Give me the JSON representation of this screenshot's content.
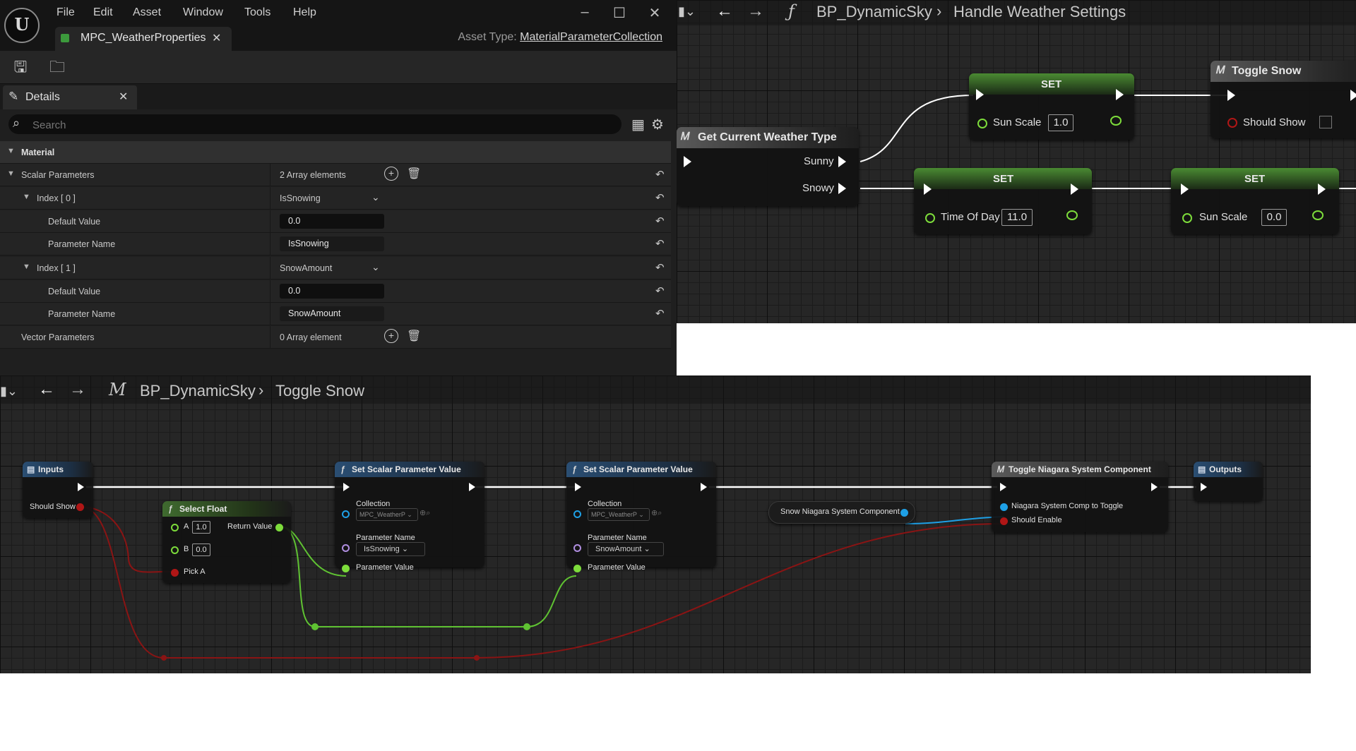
{
  "mpc_window": {
    "menu": [
      "File",
      "Edit",
      "Asset",
      "Window",
      "Tools",
      "Help"
    ],
    "asset_tab": "MPC_WeatherProperties",
    "asset_type_label": "Asset Type:",
    "asset_type_value": "MaterialParameterCollection",
    "details_tab": "Details",
    "search_placeholder": "Search",
    "section": "Material",
    "scalar_params_label": "Scalar Parameters",
    "scalar_params_count": "2 Array elements",
    "index0": {
      "label": "Index [ 0 ]",
      "value": "IsSnowing",
      "default_label": "Default Value",
      "default_value": "0.0",
      "param_label": "Parameter Name",
      "param_value": "IsSnowing"
    },
    "index1": {
      "label": "Index [ 1 ]",
      "value": "SnowAmount",
      "default_label": "Default Value",
      "default_value": "0.0",
      "param_label": "Parameter Name",
      "param_value": "SnowAmount"
    },
    "vector_params_label": "Vector Parameters",
    "vector_params_count": "0 Array element"
  },
  "graph_top": {
    "breadcrumb_root": "BP_DynamicSky",
    "breadcrumb_leaf": "Handle Weather Settings",
    "get_weather": {
      "title": "Get Current Weather Type",
      "out1": "Sunny",
      "out2": "Snowy"
    },
    "set1": {
      "title": "SET",
      "pin": "Sun Scale",
      "value": "1.0"
    },
    "set2": {
      "title": "SET",
      "pin": "Time Of Day",
      "value": "11.0"
    },
    "set3": {
      "title": "SET",
      "pin": "Sun Scale",
      "value": "0.0"
    },
    "toggle_snow": {
      "title": "Toggle Snow",
      "pin": "Should Show"
    }
  },
  "graph_bottom": {
    "breadcrumb_root": "BP_DynamicSky",
    "breadcrumb_leaf": "Toggle Snow",
    "inputs": {
      "title": "Inputs",
      "pin": "Should Show"
    },
    "select_float": {
      "title": "Select Float",
      "a_label": "A",
      "a_value": "1.0",
      "b_label": "B",
      "b_value": "0.0",
      "pick": "Pick A",
      "ret": "Return Value"
    },
    "ssp1": {
      "title": "Set Scalar Parameter Value",
      "collection": "Collection",
      "collection_value": "MPC_WeatherP",
      "pname": "Parameter Name",
      "pname_value": "IsSnowing",
      "pvalue": "Parameter Value"
    },
    "ssp2": {
      "title": "Set Scalar Parameter Value",
      "collection": "Collection",
      "collection_value": "MPC_WeatherP",
      "pname": "Parameter Name",
      "pname_value": "SnowAmount",
      "pvalue": "Parameter Value"
    },
    "niagara_var": "Snow Niagara System Component",
    "toggle_niagara": {
      "title": "Toggle Niagara System Component",
      "pin1": "Niagara System Comp to Toggle",
      "pin2": "Should Enable"
    },
    "outputs": {
      "title": "Outputs"
    }
  },
  "colors": {
    "exec": "#ffffff",
    "float": "#7ddc3b",
    "bool": "#b01616",
    "object": "#1ea0e6",
    "purple": "#b08ee0"
  }
}
